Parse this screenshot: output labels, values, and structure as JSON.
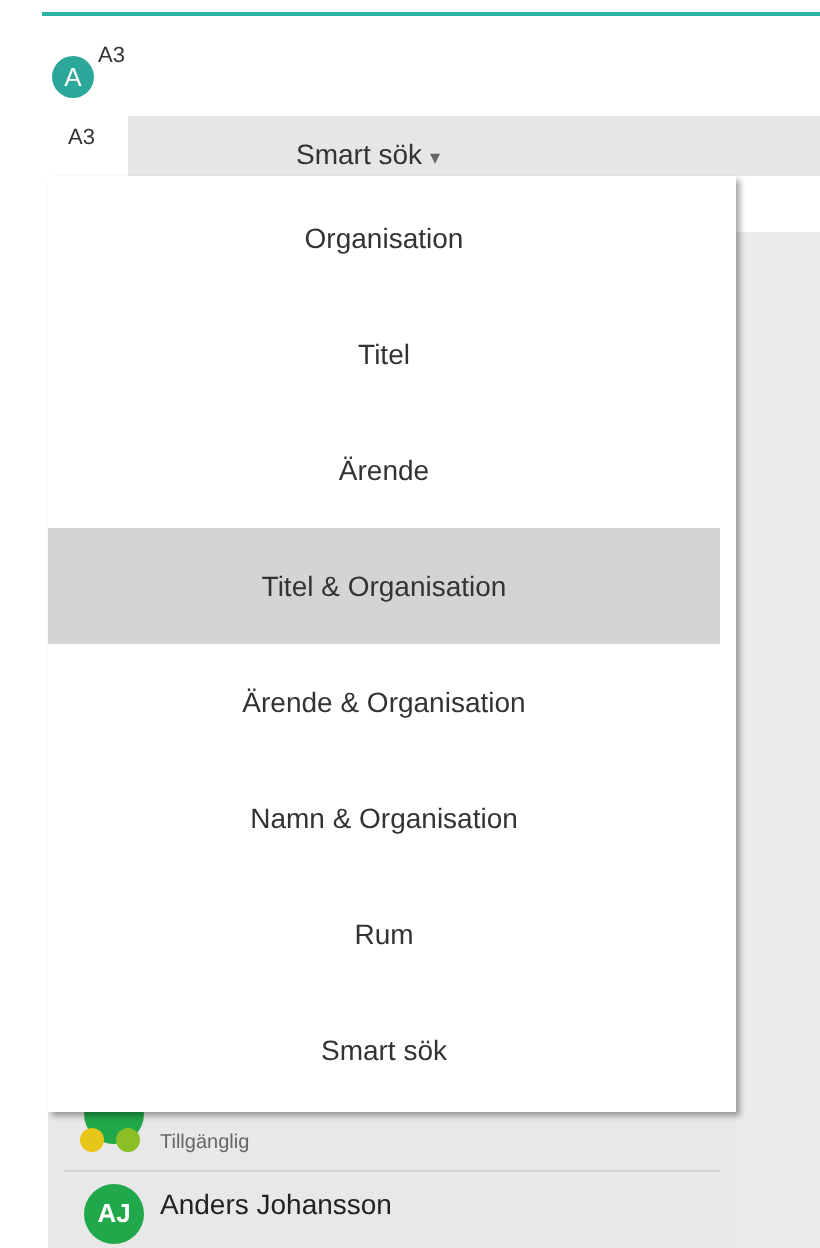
{
  "account": {
    "initial": "A",
    "label": "A3"
  },
  "tabs": [
    {
      "label": "A3",
      "selected": true
    }
  ],
  "search_mode": {
    "label": "Smart sök",
    "caret": "▾"
  },
  "menu": [
    {
      "label": "Organisation",
      "selected": false
    },
    {
      "label": "Titel",
      "selected": false
    },
    {
      "label": "Ärende",
      "selected": false
    },
    {
      "label": "Titel & Organisation",
      "selected": true
    },
    {
      "label": "Ärende & Organisation",
      "selected": false
    },
    {
      "label": "Namn & Organisation",
      "selected": false
    },
    {
      "label": "Rum",
      "selected": false
    },
    {
      "label": "Smart sök",
      "selected": false
    }
  ],
  "contacts": [
    {
      "status": "Tillgänglig",
      "dots": [
        {
          "color": "#e6c619"
        },
        {
          "color": "#8cbf26"
        }
      ]
    },
    {
      "initials": "AJ",
      "name": "Anders Johansson"
    }
  ]
}
